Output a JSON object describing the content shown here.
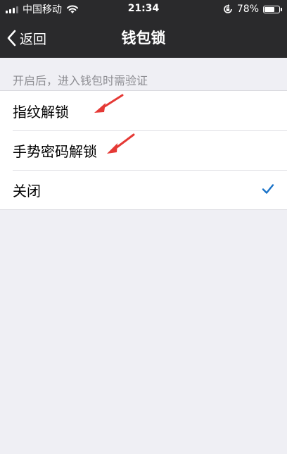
{
  "status_bar": {
    "carrier": "中国移动",
    "time": "21:34",
    "battery": "78%",
    "battery_level": 0.78,
    "icons": [
      "signal-icon",
      "wifi-icon",
      "rotation-lock-icon",
      "battery-icon"
    ]
  },
  "nav": {
    "back_label": "返回",
    "title": "钱包锁"
  },
  "section": {
    "header": "开启后，进入钱包时需验证"
  },
  "options": [
    {
      "label": "指纹解锁",
      "selected": false
    },
    {
      "label": "手势密码解锁",
      "selected": false
    },
    {
      "label": "关闭",
      "selected": true
    }
  ],
  "colors": {
    "bar_background": "#2a2a2c",
    "page_background": "#efeff4",
    "checkmark": "#1a73c8",
    "annotation_arrow": "#e53935"
  }
}
